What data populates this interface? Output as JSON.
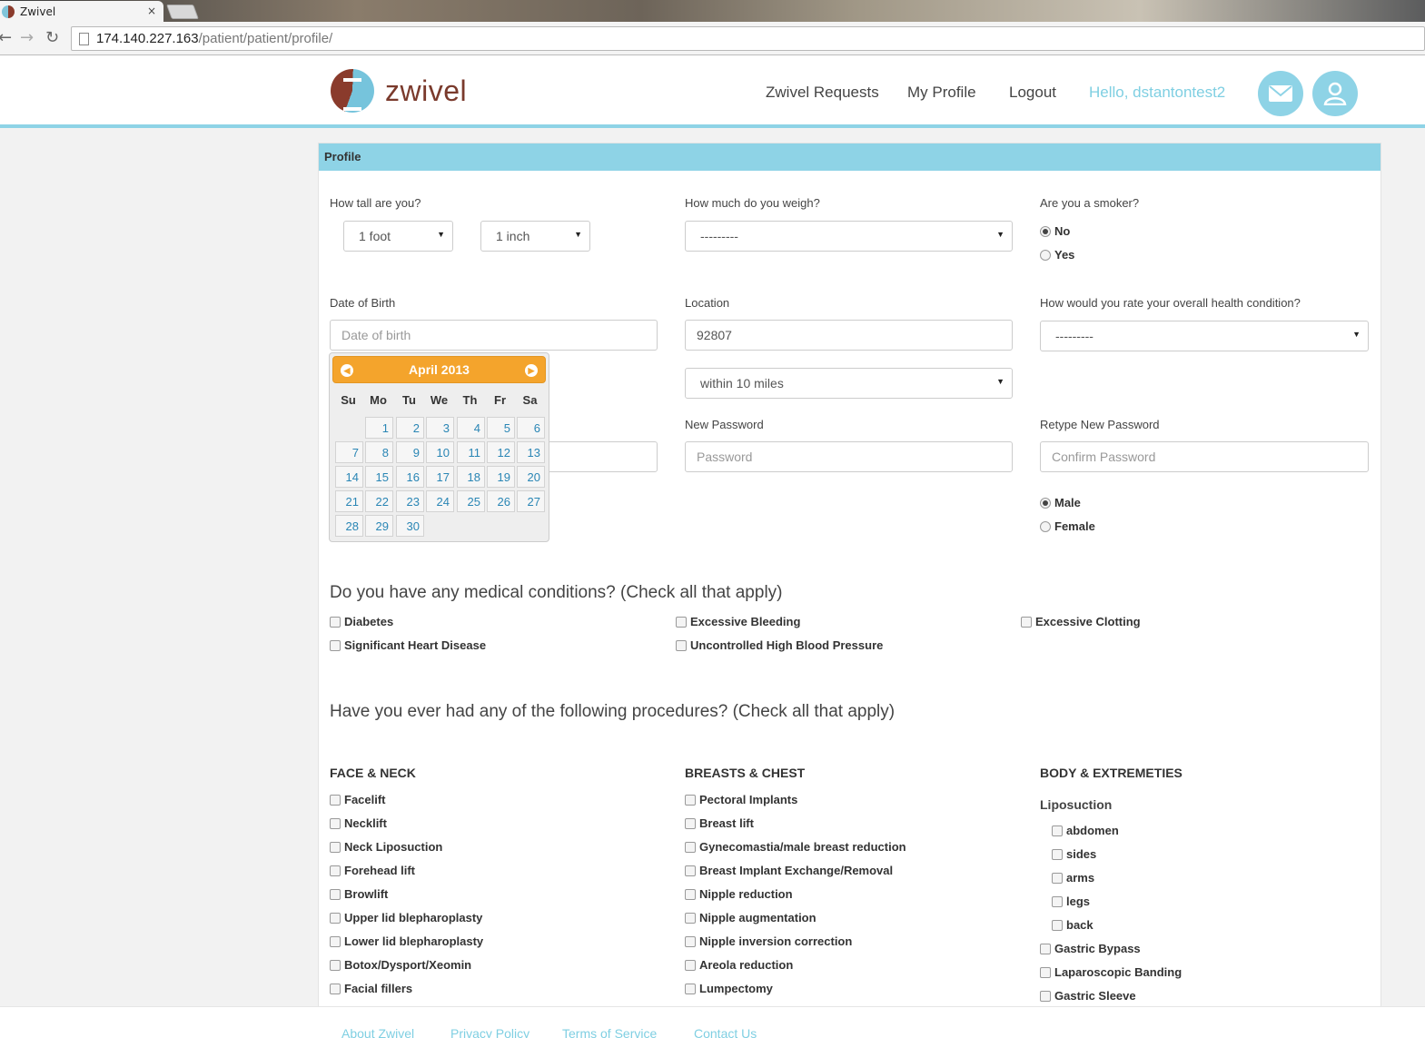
{
  "browser": {
    "tab_title": "Zwivel",
    "tab_close": "×",
    "url_host": "174.140.227.163",
    "url_path": "/patient/patient/profile/"
  },
  "header": {
    "logo_text": "zwivel",
    "nav": [
      "Zwivel Requests",
      "My Profile",
      "Logout"
    ],
    "greeting": "Hello, dstantontest2"
  },
  "profile": {
    "title": "Profile",
    "height_label": "How tall are you?",
    "height_feet": "1 foot",
    "height_inches": "1 inch",
    "weight_label": "How much do you weigh?",
    "weight_value": "---------",
    "smoker_label": "Are you a smoker?",
    "smoker_options": [
      "No",
      "Yes"
    ],
    "smoker_selected": "No",
    "dob_label": "Date of Birth",
    "dob_placeholder": "Date of birth",
    "location_label": "Location",
    "location_value": "92807",
    "radius_value": "within 10 miles",
    "health_label": "How would you rate your overall health condition?",
    "health_value": "---------",
    "new_password_label": "New Password",
    "new_password_placeholder": "Password",
    "retype_password_label": "Retype New Password",
    "retype_password_placeholder": "Confirm Password",
    "gender_options": [
      "Male",
      "Female"
    ],
    "gender_selected": "Male"
  },
  "datepicker": {
    "month_title": "April 2013",
    "weekdays": [
      "Su",
      "Mo",
      "Tu",
      "We",
      "Th",
      "Fr",
      "Sa"
    ],
    "days": [
      "1",
      "2",
      "3",
      "4",
      "5",
      "6",
      "7",
      "8",
      "9",
      "10",
      "11",
      "12",
      "13",
      "14",
      "15",
      "16",
      "17",
      "18",
      "19",
      "20",
      "21",
      "22",
      "23",
      "24",
      "25",
      "26",
      "27",
      "28",
      "29",
      "30"
    ]
  },
  "medical": {
    "heading": "Do you have any medical conditions? (Check all that apply)",
    "conditions": [
      "Diabetes",
      "Excessive Bleeding",
      "Excessive Clotting",
      "Significant Heart Disease",
      "Uncontrolled High Blood Pressure"
    ]
  },
  "procedures": {
    "heading": "Have you ever had any of the following procedures? (Check all that apply)",
    "face_neck": {
      "title": "FACE & NECK",
      "items": [
        "Facelift",
        "Necklift",
        "Neck Liposuction",
        "Forehead lift",
        "Browlift",
        "Upper lid blepharoplasty",
        "Lower lid blepharoplasty",
        "Botox/Dysport/Xeomin",
        "Facial fillers"
      ]
    },
    "breasts_chest": {
      "title": "BREASTS & CHEST",
      "items": [
        "Pectoral Implants",
        "Breast lift",
        "Gynecomastia/male breast reduction",
        "Breast Implant Exchange/Removal",
        "Nipple reduction",
        "Nipple augmentation",
        "Nipple inversion correction",
        "Areola reduction",
        "Lumpectomy"
      ]
    },
    "body": {
      "title": "BODY & EXTREMETIES",
      "lipo_title": "Liposuction",
      "lipo_items": [
        "abdomen",
        "sides",
        "arms",
        "legs",
        "back"
      ],
      "items": [
        "Gastric Bypass",
        "Laparoscopic Banding",
        "Gastric Sleeve"
      ]
    }
  },
  "footer": {
    "links": [
      "About Zwivel",
      "Privacy Policy",
      "Terms of Service",
      "Contact Us"
    ]
  }
}
